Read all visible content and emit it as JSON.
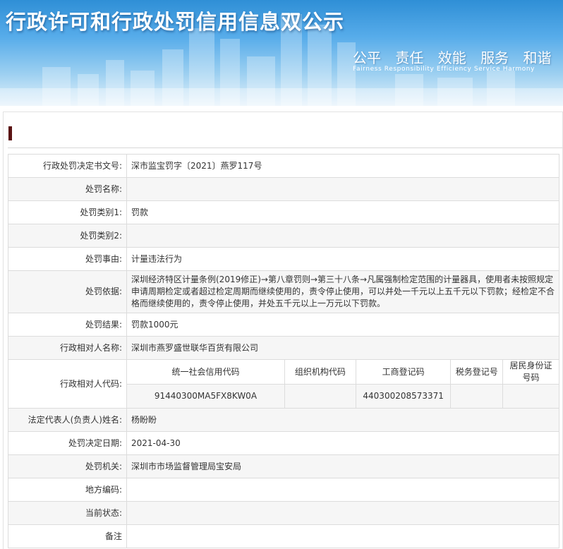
{
  "banner": {
    "title": "行政许可和行政处罚信用信息双公示",
    "slogans": [
      "公平",
      "责任",
      "效能",
      "服务",
      "和谐"
    ],
    "slogan_en": "Fairness Responsibility Efficiency Service Harmony"
  },
  "colors": {
    "marker": "#5a1212",
    "banner_sky": "#2f8fd6",
    "row_alt": "#f6f6f6",
    "border": "#dcdcdc"
  },
  "rows": [
    {
      "label": "行政处罚决定书文号:",
      "value": "深市监宝罚字〔2021〕燕罗117号"
    },
    {
      "label": "处罚名称:",
      "value": ""
    },
    {
      "label": "处罚类别1:",
      "value": "罚款"
    },
    {
      "label": "处罚类别2:",
      "value": ""
    },
    {
      "label": "处罚事由:",
      "value": "计量违法行为"
    },
    {
      "label": "处罚依据:",
      "value": "深圳经济特区计量条例(2019修正)→第八章罚则→第三十八条→凡属强制检定范围的计量器具，使用者未按照规定申请周期检定或者超过检定周期而继续使用的，责令停止使用，可以并处一千元以上五千元以下罚款；经检定不合格而继续使用的，责令停止使用，并处五千元以上一万元以下罚款。"
    },
    {
      "label": "处罚结果:",
      "value": "罚款1000元"
    },
    {
      "label": "行政相对人名称:",
      "value": "深圳市燕罗盛世联华百货有限公司"
    },
    {
      "label": "行政相对人代码:",
      "value": ""
    },
    {
      "label": "法定代表人(负责人)姓名:",
      "value": "杨盼盼"
    },
    {
      "label": "处罚决定日期:",
      "value": "2021-04-30"
    },
    {
      "label": "处罚机关:",
      "value": "深圳市市场监督管理局宝安局"
    },
    {
      "label": "地方编码:",
      "value": ""
    },
    {
      "label": "当前状态:",
      "value": ""
    },
    {
      "label": "备注",
      "value": ""
    }
  ],
  "codes": {
    "headers": [
      "统一社会信用代码",
      "组织机构代码",
      "工商登记码",
      "税务登记号",
      "居民身份证号码"
    ],
    "values": [
      "91440300MA5FX8KW0A",
      "",
      "440300208573371",
      "",
      ""
    ]
  }
}
